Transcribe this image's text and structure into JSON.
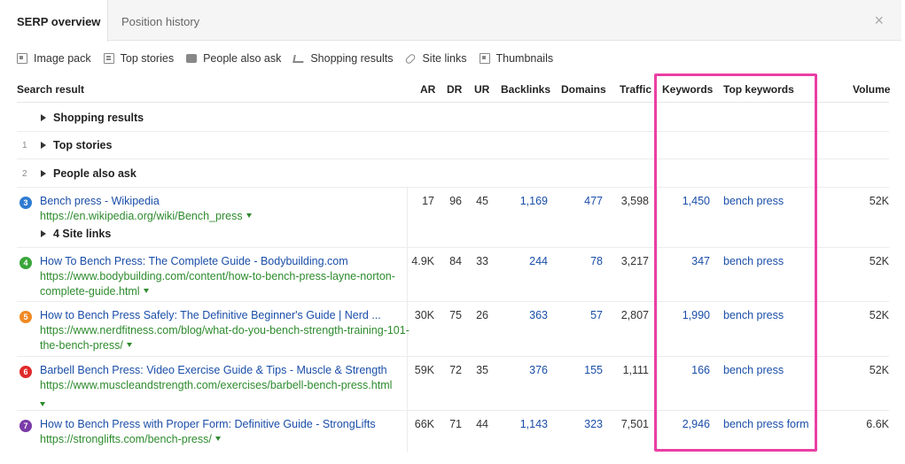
{
  "tabs": [
    {
      "label": "SERP overview",
      "active": true
    },
    {
      "label": "Position history",
      "active": false
    }
  ],
  "close_symbol": "×",
  "filters": [
    {
      "icon": "image-icon",
      "label": "Image pack"
    },
    {
      "icon": "news-icon",
      "label": "Top stories"
    },
    {
      "icon": "chat-icon",
      "label": "People also ask"
    },
    {
      "icon": "cart-icon",
      "label": "Shopping results"
    },
    {
      "icon": "link-icon",
      "label": "Site links"
    },
    {
      "icon": "image-icon",
      "label": "Thumbnails"
    }
  ],
  "columns": {
    "search_result": "Search result",
    "ar": "AR",
    "dr": "DR",
    "ur": "UR",
    "backlinks": "Backlinks",
    "domains": "Domains",
    "traffic": "Traffic",
    "keywords": "Keywords",
    "top_keywords": "Top keywords",
    "volume": "Volume"
  },
  "collapsed": [
    {
      "num": "",
      "label": "Shopping results"
    },
    {
      "num": "1",
      "label": "Top stories"
    },
    {
      "num": "2",
      "label": "People also ask"
    }
  ],
  "results": [
    {
      "pos": "3",
      "color": "#2f7bd1",
      "title": "Bench press - Wikipedia",
      "url": "https://en.wikipedia.org/wiki/Bench_press",
      "ar": "17",
      "dr": "96",
      "ur": "45",
      "backlinks": "1,169",
      "domains": "477",
      "traffic": "3,598",
      "keywords": "1,450",
      "top_keyword": "bench press",
      "volume": "52K",
      "sitelinks": "4 Site links"
    },
    {
      "pos": "4",
      "color": "#3aa53a",
      "title": "How To Bench Press: The Complete Guide - Bodybuilding.com",
      "url": "https://www.bodybuilding.com/content/how-to-bench-press-layne-norton-complete-guide.html",
      "ar": "4.9K",
      "dr": "84",
      "ur": "33",
      "backlinks": "244",
      "domains": "78",
      "traffic": "3,217",
      "keywords": "347",
      "top_keyword": "bench press",
      "volume": "52K"
    },
    {
      "pos": "5",
      "color": "#f08a24",
      "title": "How to Bench Press Safely: The Definitive Beginner's Guide | Nerd ...",
      "url": "https://www.nerdfitness.com/blog/what-do-you-bench-strength-training-101-the-bench-press/",
      "ar": "30K",
      "dr": "75",
      "ur": "26",
      "backlinks": "363",
      "domains": "57",
      "traffic": "2,807",
      "keywords": "1,990",
      "top_keyword": "bench press",
      "volume": "52K"
    },
    {
      "pos": "6",
      "color": "#e02a2a",
      "title": "Barbell Bench Press: Video Exercise Guide & Tips - Muscle & Strength",
      "url": "https://www.muscleandstrength.com/exercises/barbell-bench-press.html",
      "ar": "59K",
      "dr": "72",
      "ur": "35",
      "backlinks": "376",
      "domains": "155",
      "traffic": "1,111",
      "keywords": "166",
      "top_keyword": "bench press",
      "volume": "52K"
    },
    {
      "pos": "7",
      "color": "#7a3aa8",
      "title": "How to Bench Press with Proper Form: Definitive Guide - StrongLifts",
      "url": "https://stronglifts.com/bench-press/",
      "ar": "66K",
      "dr": "71",
      "ur": "44",
      "backlinks": "1,143",
      "domains": "323",
      "traffic": "7,501",
      "keywords": "2,946",
      "top_keyword": "bench press form",
      "volume": "6.6K"
    }
  ]
}
